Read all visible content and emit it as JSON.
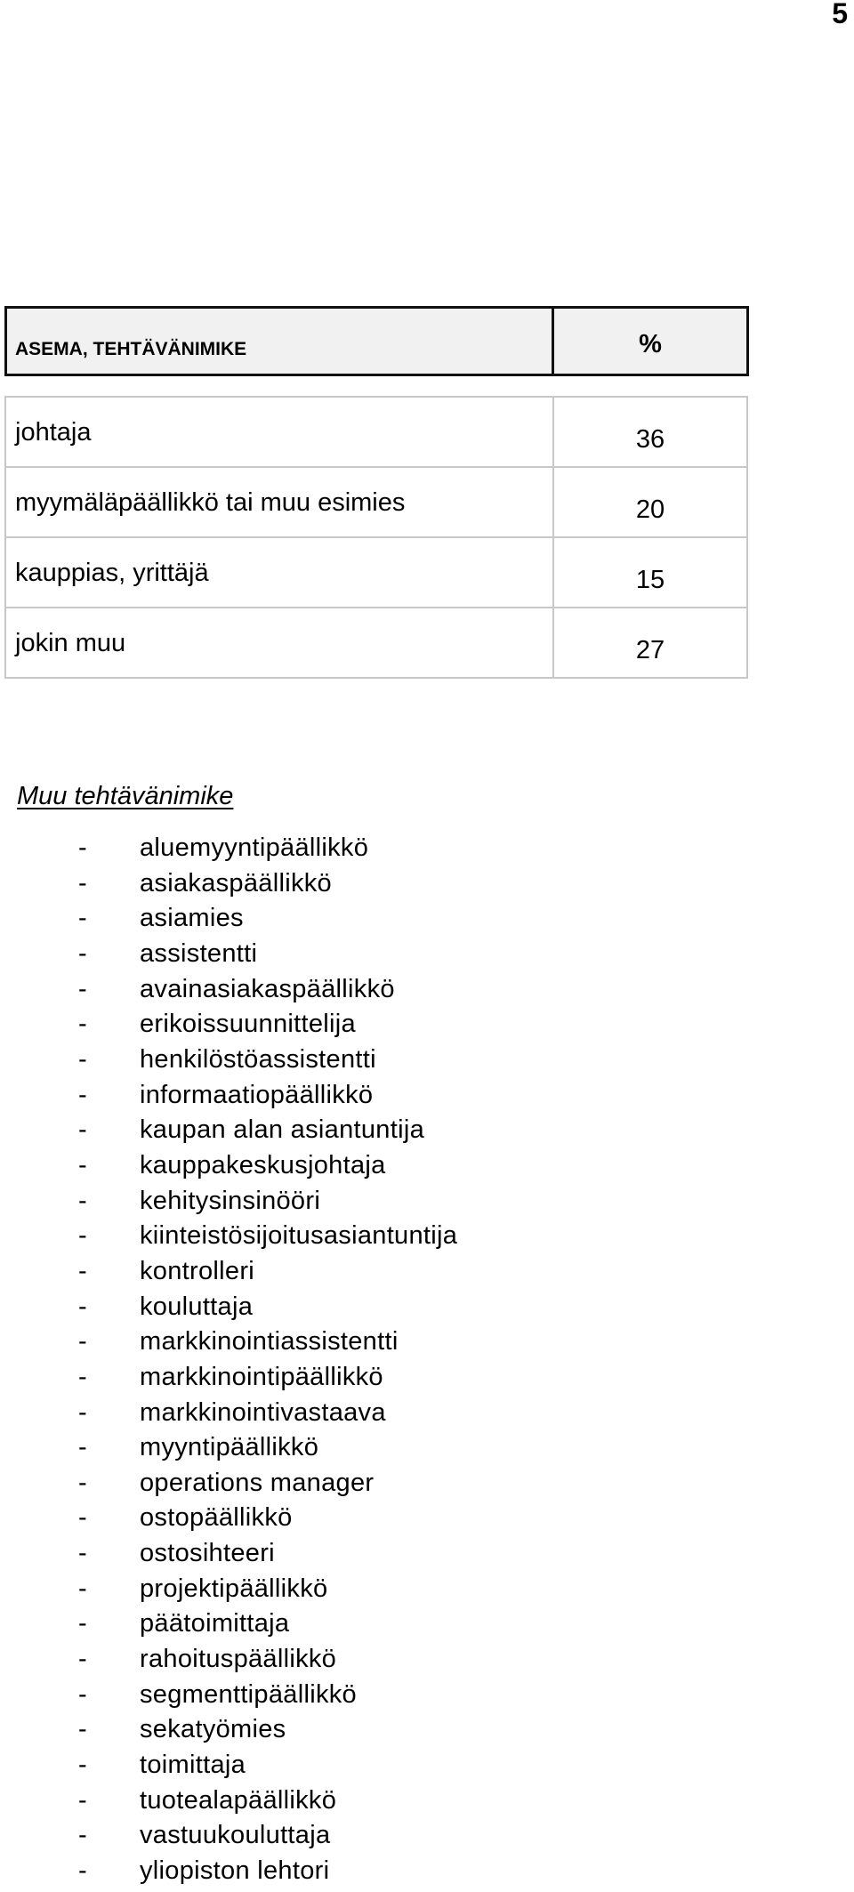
{
  "page": {
    "page_number": "5"
  },
  "table": {
    "header": {
      "label": "ASEMA, TEHTÄVÄNIMIKE",
      "value": "%"
    },
    "rows": [
      {
        "label": "johtaja",
        "value": "36"
      },
      {
        "label": "myymäläpäällikkö tai muu esimies",
        "value": "20"
      },
      {
        "label": "kauppias, yrittäjä",
        "value": "15"
      },
      {
        "label": "jokin muu",
        "value": "27"
      }
    ]
  },
  "other_titles": {
    "heading": "Muu tehtävänimike",
    "bullet": "-",
    "items": [
      "aluemyyntipäällikkö",
      "asiakaspäällikkö",
      "asiamies",
      "assistentti",
      "avainasiakaspäällikkö",
      "erikoissuunnittelija",
      "henkilöstöassistentti",
      "informaatiopäällikkö",
      "kaupan alan asiantuntija",
      "kauppakeskusjohtaja",
      "kehitysinsinööri",
      "kiinteistösijoitusasiantuntija",
      "kontrolleri",
      "kouluttaja",
      "markkinointiassistentti",
      "markkinointipäällikkö",
      "markkinointivastaava",
      "myyntipäällikkö",
      "operations manager",
      "ostopäällikkö",
      "ostosihteeri",
      "projektipäällikkö",
      "päätoimittaja",
      "rahoituspäällikkö",
      "segmenttipäällikkö",
      "sekatyömies",
      "toimittaja",
      "tuotealapäällikkö",
      "vastuukouluttaja",
      "yliopiston lehtori"
    ]
  }
}
